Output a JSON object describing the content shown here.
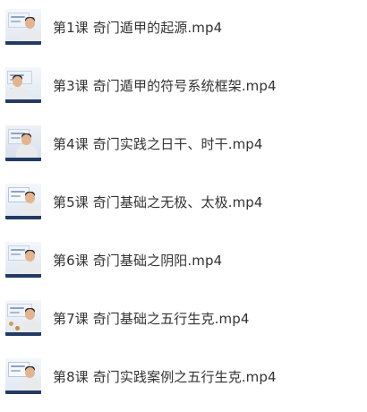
{
  "files": [
    {
      "name": "第1课 奇门遁甲的起源.mp4",
      "thumbnail": "video-thumbnail"
    },
    {
      "name": "第3课 奇门遁甲的符号系统框架.mp4",
      "thumbnail": "video-thumbnail"
    },
    {
      "name": "第4课 奇门实践之日干、时干.mp4",
      "thumbnail": "video-thumbnail"
    },
    {
      "name": "第5课 奇门基础之无极、太极.mp4",
      "thumbnail": "video-thumbnail"
    },
    {
      "name": "第6课 奇门基础之阴阳.mp4",
      "thumbnail": "video-thumbnail"
    },
    {
      "name": "第7课 奇门基础之五行生克.mp4",
      "thumbnail": "video-thumbnail"
    },
    {
      "name": "第8课 奇门实践案例之五行生克.mp4",
      "thumbnail": "video-thumbnail"
    }
  ],
  "colors": {
    "text": "#333333",
    "background": "#ffffff"
  }
}
